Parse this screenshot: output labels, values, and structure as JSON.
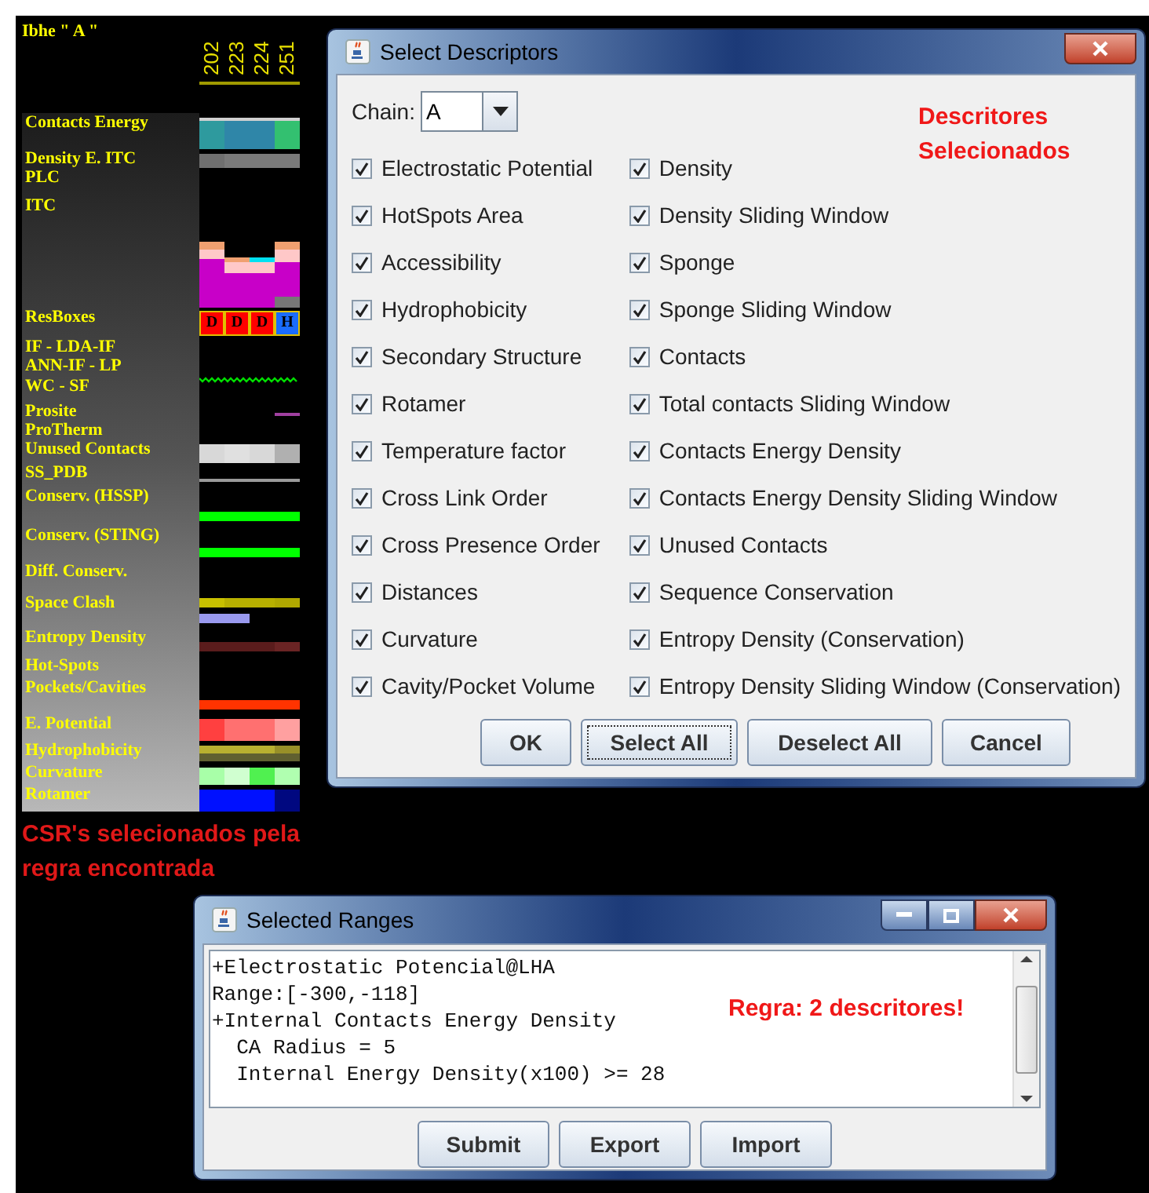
{
  "track_panel": {
    "title": "Ibhe \" A \"",
    "columns": [
      "202",
      "223",
      "224",
      "251"
    ],
    "tracks": [
      {
        "label": "Contacts Energy",
        "kind": "cells",
        "stripes": [
          {
            "kind": "line",
            "cells": [
              {
                "kind": "fill",
                "color": "#d0d0d0"
              },
              {
                "kind": "fill",
                "color": "#d0d0d0"
              },
              {
                "kind": "fill",
                "color": "#d0d0d0"
              },
              {
                "kind": "fill",
                "color": "#d0d0d0"
              }
            ]
          },
          {
            "kind": "band",
            "cells": [
              {
                "kind": "fill",
                "color": "#2e9a9e"
              },
              {
                "kind": "fill",
                "color": "#2f86a8"
              },
              {
                "kind": "fill",
                "color": "#2f86a8"
              },
              {
                "kind": "fill",
                "color": "#33c070"
              }
            ]
          }
        ]
      },
      {
        "label": "Density E. ITC",
        "kind": "cells",
        "stripes": [
          {
            "kind": "band",
            "cells": [
              {
                "kind": "fill",
                "color": "#707070"
              },
              {
                "kind": "fill",
                "color": "#7a7a7a"
              },
              {
                "kind": "fill",
                "color": "#7a7a7a"
              },
              {
                "kind": "fill",
                "color": "#7a7a7a"
              }
            ]
          }
        ]
      },
      {
        "label": "PLC",
        "kind": "empty"
      },
      {
        "label": "ITC",
        "kind": "bars"
      },
      {
        "label": "ResBoxes",
        "kind": "boxes",
        "boxes": [
          {
            "letter": "D",
            "color": "#ff0000"
          },
          {
            "letter": "D",
            "color": "#ff0000"
          },
          {
            "letter": "D",
            "color": "#ff0000"
          },
          {
            "letter": "H",
            "color": "#1a6cff"
          }
        ]
      },
      {
        "label": "IF - LDA-IF",
        "kind": "empty"
      },
      {
        "label": "ANN-IF - LP",
        "kind": "empty"
      },
      {
        "label": "WC - SF",
        "kind": "wave"
      },
      {
        "label": "Prosite",
        "kind": "bar",
        "stripes": [
          {
            "kind": "line",
            "cells": [
              {
                "kind": "empty"
              },
              {
                "kind": "empty"
              },
              {
                "kind": "empty"
              },
              {
                "kind": "fill",
                "color": "#a040a0"
              }
            ]
          }
        ]
      },
      {
        "label": "ProTherm",
        "kind": "empty"
      },
      {
        "label": "Unused Contacts",
        "kind": "cells",
        "stripes": [
          {
            "kind": "band",
            "cells": [
              {
                "kind": "fill",
                "color": "#d8d8d8"
              },
              {
                "kind": "fill",
                "color": "#e0e0e0"
              },
              {
                "kind": "fill",
                "color": "#d8d8d8"
              },
              {
                "kind": "fill",
                "color": "#b0b0b0"
              }
            ]
          }
        ]
      },
      {
        "label": "SS_PDB",
        "kind": "bar",
        "stripes": [
          {
            "kind": "line",
            "cells": [
              {
                "kind": "fill",
                "color": "#9a9a9a"
              },
              {
                "kind": "fill",
                "color": "#9a9a9a"
              },
              {
                "kind": "fill",
                "color": "#9a9a9a"
              },
              {
                "kind": "fill",
                "color": "#9a9a9a"
              }
            ]
          }
        ]
      },
      {
        "label": "Conserv. (HSSP)",
        "kind": "bar",
        "stripes": [
          {
            "kind": "band",
            "cells": [
              {
                "kind": "fill",
                "color": "#00ff00"
              },
              {
                "kind": "fill",
                "color": "#00ff00"
              },
              {
                "kind": "fill",
                "color": "#00ff00"
              },
              {
                "kind": "fill",
                "color": "#00ff00"
              }
            ]
          }
        ]
      },
      {
        "label": "Conserv. (STING)",
        "kind": "bar",
        "stripes": [
          {
            "kind": "band",
            "cells": [
              {
                "kind": "fill",
                "color": "#00ff00"
              },
              {
                "kind": "fill",
                "color": "#00ff00"
              },
              {
                "kind": "fill",
                "color": "#00ff00"
              },
              {
                "kind": "fill",
                "color": "#00ff00"
              }
            ]
          }
        ]
      },
      {
        "label": "Diff. Conserv.",
        "kind": "empty"
      },
      {
        "label": "Space Clash",
        "kind": "bar",
        "stripes": [
          {
            "kind": "band",
            "cells": [
              {
                "kind": "fill",
                "color": "#c8c000"
              },
              {
                "kind": "fill",
                "color": "#b8b000"
              },
              {
                "kind": "fill",
                "color": "#b8b000"
              },
              {
                "kind": "fill",
                "color": "#b0a800"
              }
            ]
          },
          {
            "kind": "band",
            "cells": [
              {
                "kind": "fill",
                "color": "#9999ee"
              },
              {
                "kind": "fill",
                "color": "#9999ee"
              },
              {
                "kind": "empty"
              },
              {
                "kind": "empty"
              }
            ]
          }
        ]
      },
      {
        "label": "Entropy Density",
        "kind": "bar",
        "stripes": [
          {
            "kind": "band",
            "cells": [
              {
                "kind": "fill",
                "color": "#5a1c1c"
              },
              {
                "kind": "fill",
                "color": "#5a1c1c"
              },
              {
                "kind": "fill",
                "color": "#5a1c1c"
              },
              {
                "kind": "fill",
                "color": "#6a2424"
              }
            ]
          }
        ]
      },
      {
        "label": "Hot-Spots",
        "kind": "empty"
      },
      {
        "label": "Pockets/Cavities",
        "kind": "bar",
        "stripes": [
          {
            "kind": "band",
            "cells": [
              {
                "kind": "fill",
                "color": "#ff3300"
              },
              {
                "kind": "fill",
                "color": "#ff3300"
              },
              {
                "kind": "fill",
                "color": "#ff3300"
              },
              {
                "kind": "fill",
                "color": "#ff3300"
              }
            ]
          }
        ]
      },
      {
        "label": "E. Potential",
        "kind": "cells",
        "stripes": [
          {
            "kind": "band",
            "cells": [
              {
                "kind": "fill",
                "color": "#ff4040"
              },
              {
                "kind": "fill",
                "color": "#ff7070"
              },
              {
                "kind": "fill",
                "color": "#ff7070"
              },
              {
                "kind": "fill",
                "color": "#ffa0a0"
              }
            ]
          }
        ]
      },
      {
        "label": "Hydrophobicity",
        "kind": "cells",
        "stripes": [
          {
            "kind": "band",
            "cells": [
              {
                "kind": "fill",
                "color": "#b8b030"
              },
              {
                "kind": "fill",
                "color": "#b8b030"
              },
              {
                "kind": "fill",
                "color": "#b8b030"
              },
              {
                "kind": "fill",
                "color": "#989028"
              }
            ]
          },
          {
            "kind": "band",
            "cells": [
              {
                "kind": "fill",
                "color": "#606030"
              },
              {
                "kind": "fill",
                "color": "#606030"
              },
              {
                "kind": "fill",
                "color": "#606030"
              },
              {
                "kind": "fill",
                "color": "#606030"
              }
            ]
          }
        ]
      },
      {
        "label": "Curvature",
        "kind": "cells",
        "stripes": [
          {
            "kind": "band",
            "cells": [
              {
                "kind": "fill",
                "color": "#a8ffa8"
              },
              {
                "kind": "fill",
                "color": "#d0ffd0"
              },
              {
                "kind": "fill",
                "color": "#50f050"
              },
              {
                "kind": "fill",
                "color": "#b0ffb0"
              }
            ]
          }
        ]
      },
      {
        "label": "Rotamer",
        "kind": "cells",
        "stripes": [
          {
            "kind": "band",
            "cells": [
              {
                "kind": "fill",
                "color": "#0010ff"
              },
              {
                "kind": "fill",
                "color": "#0010ff"
              },
              {
                "kind": "fill",
                "color": "#0010ff"
              },
              {
                "kind": "fill",
                "color": "#000880"
              }
            ]
          }
        ]
      }
    ],
    "note": "CSR's selecionados pela regra encontrada"
  },
  "select_descriptors": {
    "title": "Select Descriptors",
    "chain_label": "Chain:",
    "chain_value": "A",
    "note": "Descritores Selecionados",
    "columns": [
      [
        {
          "label": "Electrostatic Potential",
          "checked": true
        },
        {
          "label": "HotSpots Area",
          "checked": true
        },
        {
          "label": "Accessibility",
          "checked": true
        },
        {
          "label": "Hydrophobicity",
          "checked": true
        },
        {
          "label": "Secondary Structure",
          "checked": true
        },
        {
          "label": "Rotamer",
          "checked": true
        },
        {
          "label": "Temperature factor",
          "checked": true
        },
        {
          "label": "Cross Link Order",
          "checked": true
        },
        {
          "label": "Cross Presence Order",
          "checked": true
        },
        {
          "label": "Distances",
          "checked": true
        },
        {
          "label": "Curvature",
          "checked": true
        },
        {
          "label": "Cavity/Pocket Volume",
          "checked": true
        }
      ],
      [
        {
          "label": "Density",
          "checked": true
        },
        {
          "label": "Density Sliding Window",
          "checked": true
        },
        {
          "label": "Sponge",
          "checked": true
        },
        {
          "label": "Sponge Sliding Window",
          "checked": true
        },
        {
          "label": "Contacts",
          "checked": true
        },
        {
          "label": "Total contacts Sliding Window",
          "checked": true
        },
        {
          "label": "Contacts Energy Density",
          "checked": true
        },
        {
          "label": "Contacts Energy Density Sliding Window",
          "checked": true
        },
        {
          "label": "Unused Contacts",
          "checked": true
        },
        {
          "label": "Sequence Conservation",
          "checked": true
        },
        {
          "label": "Entropy Density (Conservation)",
          "checked": true
        },
        {
          "label": "Entropy Density Sliding Window (Conservation)",
          "checked": true
        }
      ]
    ],
    "buttons": [
      {
        "label": "OK",
        "focused": false
      },
      {
        "label": "Select All",
        "focused": true
      },
      {
        "label": "Deselect All",
        "focused": false
      },
      {
        "label": "Cancel",
        "focused": false
      }
    ]
  },
  "selected_ranges": {
    "title": "Selected Ranges",
    "lines": [
      "+Electrostatic Potencial@LHA",
      "Range:[-300,-118]",
      "+Internal Contacts Energy Density",
      "  CA Radius = 5",
      "  Internal Energy Density(x100) >= 28"
    ],
    "note": "Regra: 2 descritores!",
    "buttons": [
      "Submit",
      "Export",
      "Import"
    ]
  }
}
